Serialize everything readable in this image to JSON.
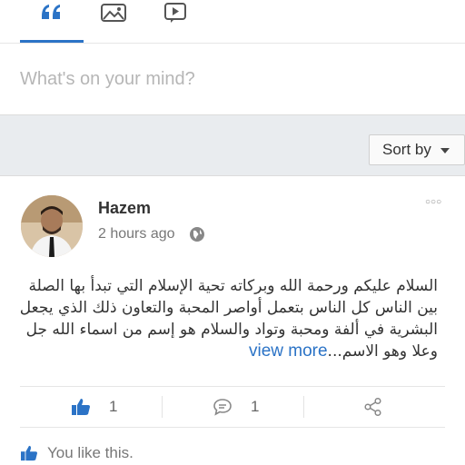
{
  "tabs": [
    {
      "icon": "quote-icon",
      "active": true
    },
    {
      "icon": "photo-icon",
      "active": false
    },
    {
      "icon": "video-icon",
      "active": false
    }
  ],
  "composer": {
    "placeholder": "What's on your mind?"
  },
  "sort": {
    "label": "Sort by"
  },
  "post": {
    "author": "Hazem",
    "time": "2 hours ago",
    "text_lines": [
      "السلام عليكم ورحمة الله وبركاته تحية الإسلام التي تبدأ بها الصلة",
      "بين الناس كل الناس بتعمل أواصر المحبة والتعاون ذلك الذي يجعل",
      "البشرية في ألفة ومحبة وتواد والسلام هو إسم من اسماء الله جل",
      "وعلا وهو الاسم..."
    ],
    "view_more": "view more",
    "like_count": "1",
    "comment_count": "1",
    "likers_text": "You like this."
  },
  "colors": {
    "accent": "#2b73c6",
    "sortbar_bg": "#e9ecef"
  }
}
